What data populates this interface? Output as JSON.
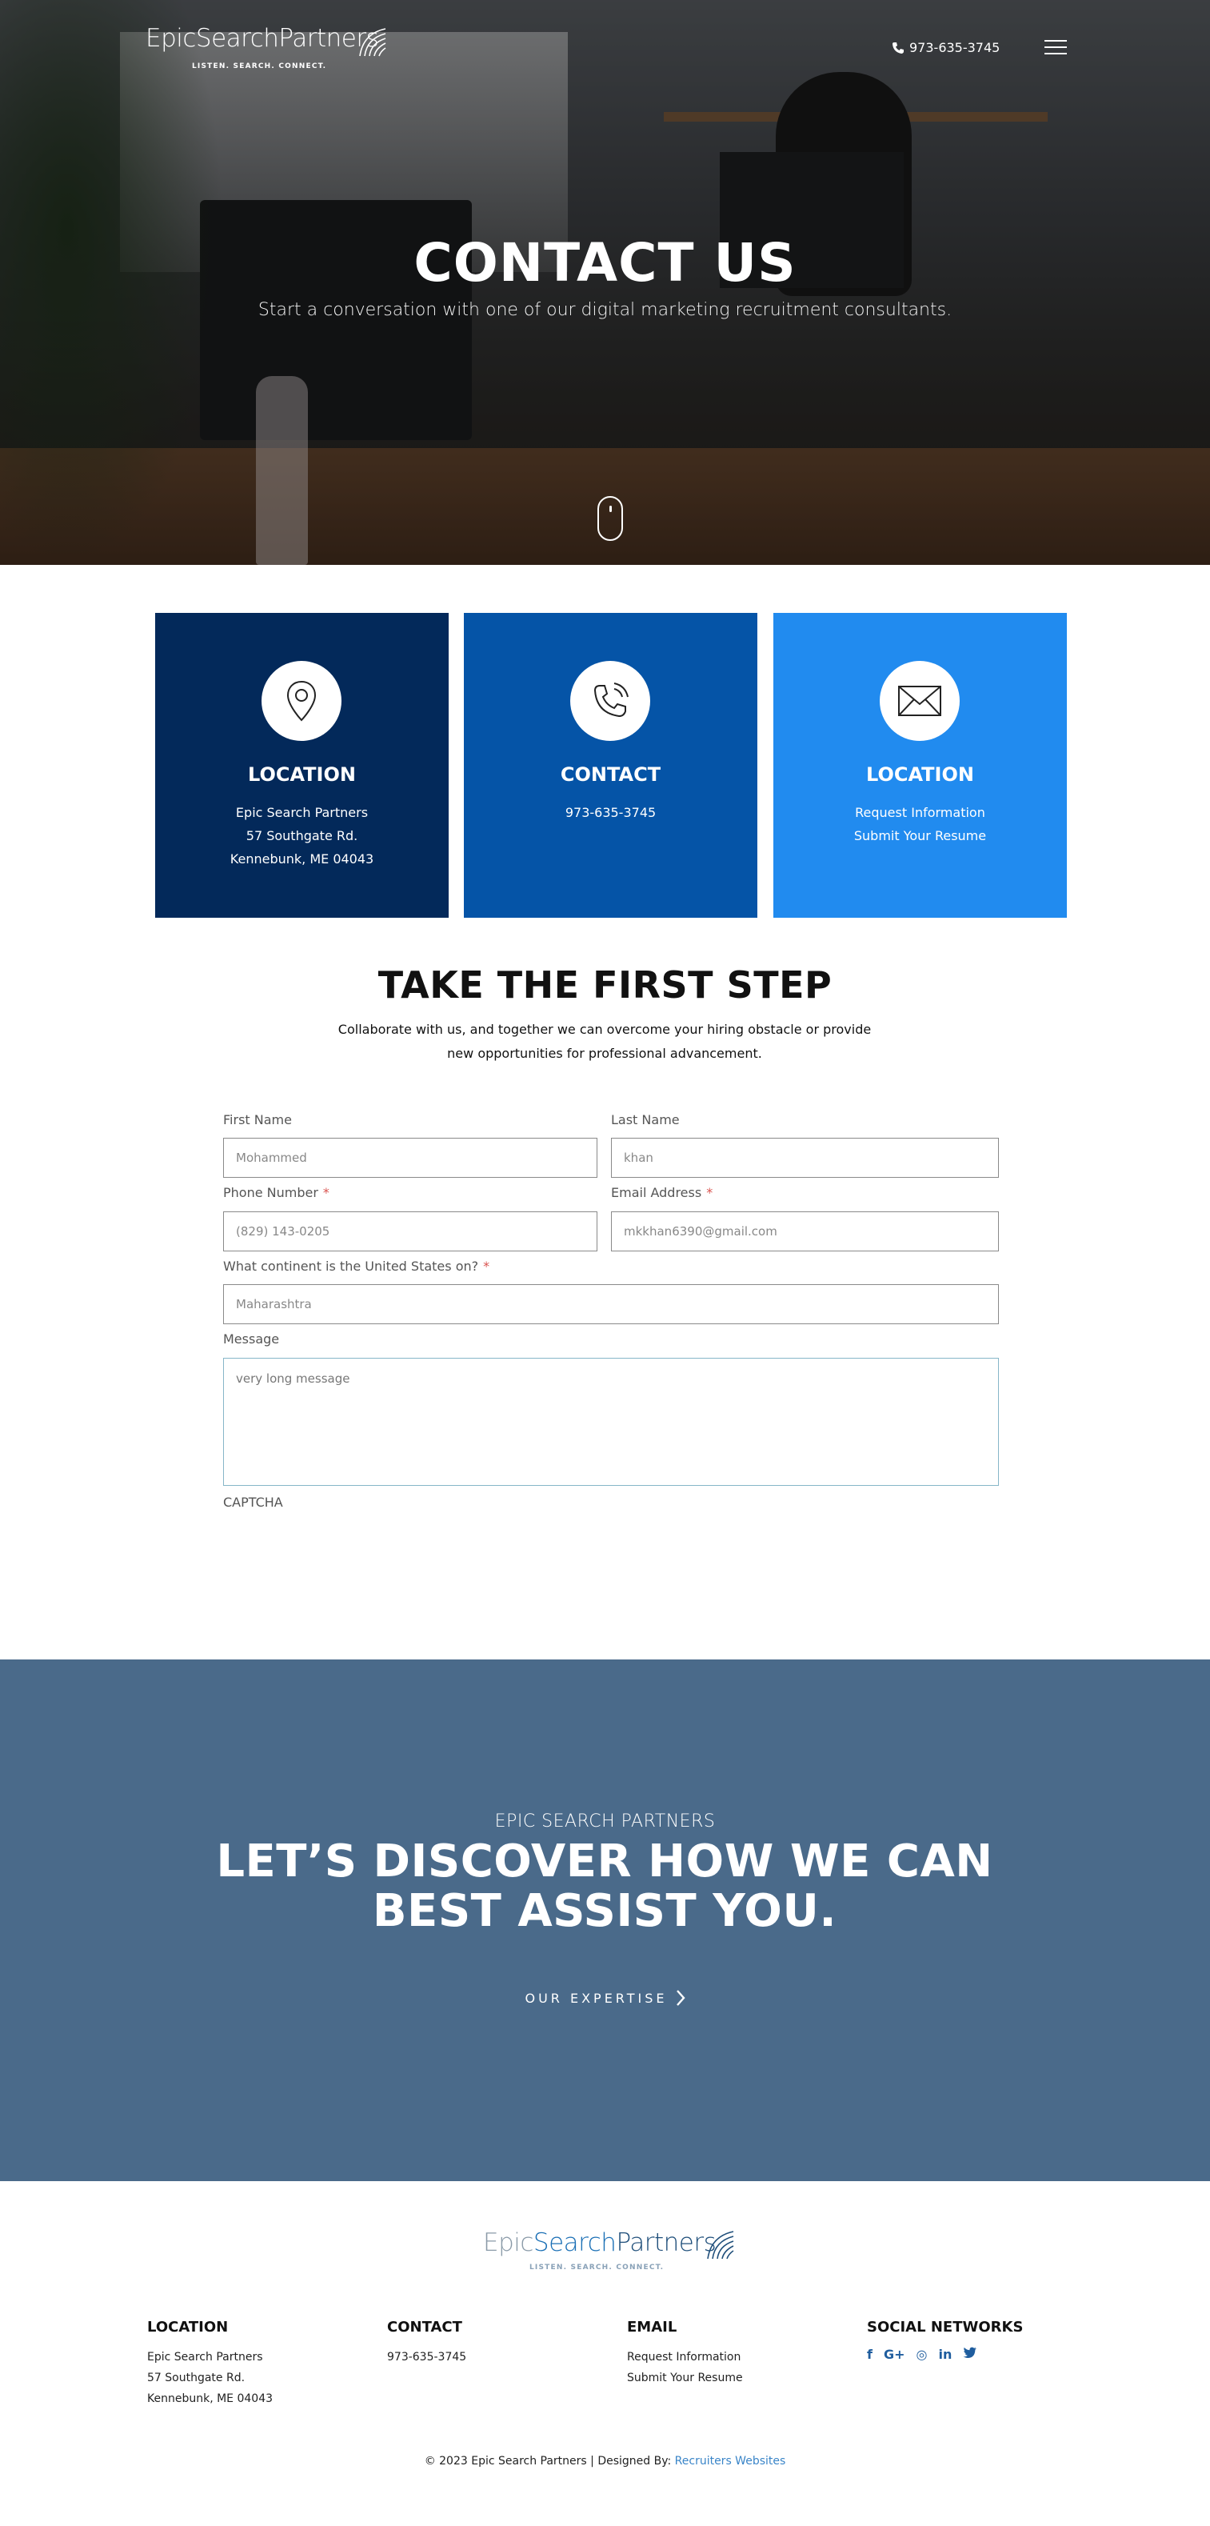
{
  "header": {
    "logo_name": "EpicSearchPartners",
    "logo_tagline": "LISTEN. SEARCH. CONNECT.",
    "phone": "973-635-3745",
    "menu_icon": "hamburger-icon"
  },
  "hero": {
    "title": "CONTACT US",
    "subtitle": "Start a conversation with one of our digital marketing recruitment consultants.",
    "scroll_icon": "mouse-scroll-icon"
  },
  "cards": [
    {
      "icon": "map-pin-icon",
      "title": "LOCATION",
      "lines": [
        "Epic Search Partners",
        "57 Southgate Rd.",
        "Kennebunk, ME 04043"
      ],
      "color": "#03295a"
    },
    {
      "icon": "phone-icon",
      "title": "CONTACT",
      "lines": [
        "973-635-3745"
      ],
      "color": "#0554a7"
    },
    {
      "icon": "envelope-icon",
      "title": "LOCATION",
      "lines": [
        "Request Information",
        "Submit Your Resume"
      ],
      "color": "#218bef"
    }
  ],
  "form_section": {
    "title": "TAKE THE FIRST STEP",
    "description": "Collaborate with us, and together we can overcome your hiring obstacle or provide new opportunities for professional advancement.",
    "first_name": {
      "label": "First Name",
      "placeholder": "Mohammed"
    },
    "last_name": {
      "label": "Last Name",
      "placeholder": "khan"
    },
    "phone": {
      "label": "Phone Number",
      "required": "*",
      "placeholder": "(829) 143-0205"
    },
    "email": {
      "label": "Email Address",
      "required": "*",
      "placeholder": "mkkhan6390@gmail.com"
    },
    "question": {
      "label": "What continent is the United States on?",
      "required": "*",
      "placeholder": "Maharashtra"
    },
    "message": {
      "label": "Message",
      "placeholder": "very long message"
    },
    "captcha_label": "CAPTCHA"
  },
  "cta": {
    "eyebrow": "EPIC SEARCH PARTNERS",
    "headline": "LET’S DISCOVER HOW WE CAN BEST ASSIST YOU.",
    "button": "OUR EXPERTISE",
    "background": "#4a6a8a"
  },
  "footer": {
    "logo_epic": "Epic",
    "logo_search": "Search",
    "logo_partners": "Partners",
    "logo_tagline": "LISTEN. SEARCH. CONNECT.",
    "location": {
      "title": "LOCATION",
      "lines": [
        "Epic Search Partners",
        "57 Southgate Rd.",
        "Kennebunk, ME 04043"
      ]
    },
    "contact": {
      "title": "CONTACT",
      "lines": [
        "973-635-3745"
      ]
    },
    "email": {
      "title": "EMAIL",
      "lines": [
        "Request Information",
        "Submit Your Resume"
      ]
    },
    "social": {
      "title": "SOCIAL NETWORKS",
      "icons": [
        "f",
        "G+",
        "◎",
        "in",
        "t"
      ]
    },
    "copyright_prefix": "2023 Epic Search Partners | Designed By:",
    "copyright_link": "Recruiters Websites"
  }
}
